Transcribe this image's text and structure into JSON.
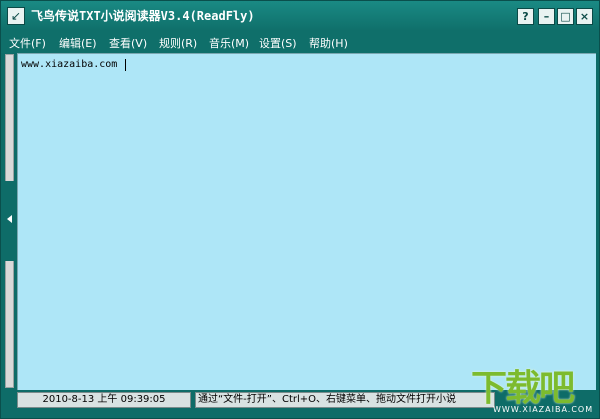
{
  "window": {
    "title": "飞鸟传说TXT小说阅读器V3.4(ReadFly)",
    "buttons": {
      "help": "?",
      "minimize": "–",
      "maximize": "□",
      "close": "×"
    }
  },
  "menubar": {
    "items": [
      {
        "label": "文件(F)"
      },
      {
        "label": "编辑(E)"
      },
      {
        "label": "查看(V)"
      },
      {
        "label": "规则(R)"
      },
      {
        "label": "音乐(M)"
      },
      {
        "label": "设置(S)"
      },
      {
        "label": "帮助(H)"
      }
    ]
  },
  "content": {
    "text": "www.xiazaiba.com"
  },
  "status": {
    "datetime": "2010-8-13  上午  09:39:05",
    "hint": "通过“文件-打开”、Ctrl+O、右键菜单、拖动文件打开小说"
  },
  "watermark": {
    "logo": "下载吧",
    "url": "WWW.XIAZAIBA.COM"
  },
  "colors": {
    "chrome": "#0e6c68",
    "content_bg": "#aee6f7",
    "menu_text": "#ffffff"
  }
}
